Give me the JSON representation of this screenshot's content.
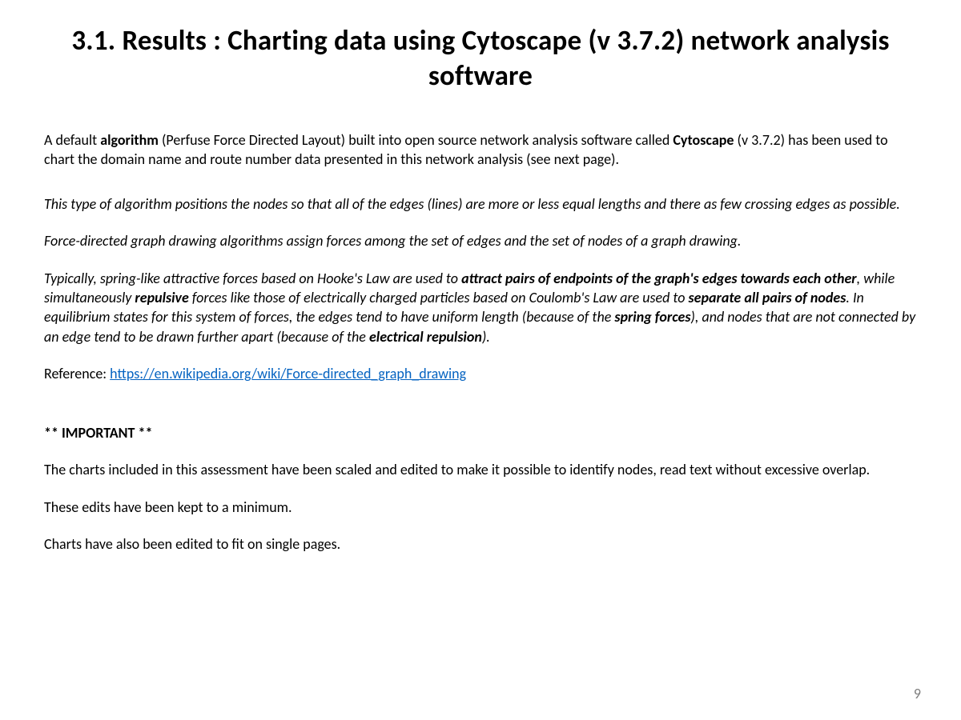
{
  "title": "3.1. Results : Charting data using Cytoscape (v 3.7.2) network analysis software",
  "p1": {
    "a": "A default ",
    "b": "algorithm",
    "c": " (Perfuse Force Directed Layout) built into open source network analysis software called ",
    "d": "Cytoscape",
    "e": " (v 3.7.2) has been used to chart the domain name and route number data presented in this network analysis (see next page)."
  },
  "p2": "This type of algorithm positions the nodes so that all of the edges (lines) are more or less equal lengths and there as few crossing edges as possible.",
  "p3": "Force-directed graph drawing algorithms assign forces among the set of edges and the set of nodes of a graph drawing.",
  "p4": {
    "a": "Typically, spring-like attractive forces based on Hooke's Law are used to ",
    "b": "attract pairs of endpoints of the graph's edges towards each other",
    "c": ", while simultaneously ",
    "d": "repulsive",
    "e": " forces like those of electrically charged particles based on Coulomb's Law are used to ",
    "f": "separate all pairs of nodes",
    "g": ". In equilibrium states for this system of forces, the edges tend to have uniform length (because of the ",
    "h": "spring forces",
    "i": "), and nodes that are not connected by an edge tend to be drawn further apart (because of the ",
    "j": "electrical repulsion",
    "k": ")."
  },
  "ref": {
    "label": "Reference: ",
    "url_text": "https://en.wikipedia.org/wiki/Force-directed_graph_drawing",
    "url_href": "https://en.wikipedia.org/wiki/Force-directed_graph_drawing"
  },
  "important": "** IMPORTANT **",
  "p5": "The charts included in this assessment have been scaled and edited to make it possible to identify nodes, read text without excessive overlap.",
  "p6": "These edits have been kept to a minimum.",
  "p7": "Charts have also been edited to fit on single pages.",
  "page_number": "9"
}
